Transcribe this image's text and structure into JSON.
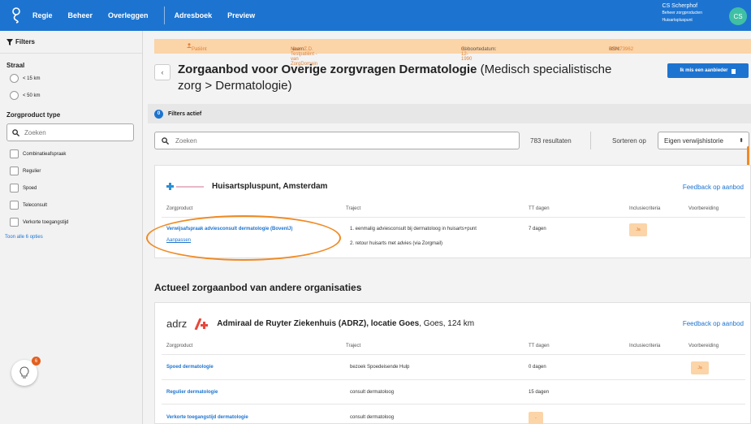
{
  "topnav": {
    "items": [
      "Regie",
      "Beheer",
      "Overleggen",
      "Adresboek",
      "Preview"
    ]
  },
  "user": {
    "name": "CS Scherphof",
    "role": "Beheer zorgproducten",
    "org": "Huisartspluspunt",
    "initials": "CS"
  },
  "sidebar": {
    "title": "Filters",
    "straal": {
      "label": "Straal",
      "options": [
        "< 15 km",
        "< 50 km"
      ]
    },
    "zorgproduct": {
      "label": "Zorgproduct type",
      "placeholder": "Zoeken",
      "options": [
        "Combinatieafspraak",
        "Regulier",
        "Spoed",
        "Teleconsult",
        "Verkorte toegangstijd"
      ],
      "more": "Toon alle 6 opties"
    },
    "notification_count": "6"
  },
  "patient": {
    "label": "Patiënt",
    "naam_label": "Naam:",
    "naam": "Mevr. Z.D. Testpatiënt - van ZorgDomein",
    "geb_label": "Geboortedatum:",
    "geb": "31-12-1990",
    "bsn_label": "BSN:",
    "bsn": "900073962"
  },
  "header": {
    "back": "‹",
    "title_bold": "Zorgaanbod voor Overige zorgvragen Dermatologie",
    "title_rest": " (Medisch specialistische zorg > Dermatologie)",
    "missing_button": "Ik mis een aanbieder"
  },
  "filterbar": {
    "count": "0",
    "label": "Filters actief"
  },
  "search": {
    "placeholder": "Zoeken",
    "results": "783 resultaten",
    "sort_label": "Sorteren op",
    "sort_value": "Eigen verwijshistorie"
  },
  "columns": [
    "Zorgproduct",
    "Traject",
    "TT dagen",
    "Inclusiecriteria",
    "Voorbereiding"
  ],
  "card1": {
    "provider": "Huisartspluspunt, Amsterdam",
    "feedback": "Feedback op aanbod",
    "product": "Verwijsafspraak adviesconsult dermatologie (BovenIJ)",
    "edit": "Aanpassen",
    "traject1": "1. eenmalig adviesconsult bij dermatoloog in huisarts+punt",
    "traject2": "2. retour huisarts met advies (via Zorgmail)",
    "tt": "7 dagen",
    "incl": "Ja"
  },
  "section_title": "Actueel zorgaanbod van andere organisaties",
  "card2": {
    "logo": "adrz",
    "provider": "Admiraal de Ruyter Ziekenhuis (ADRZ), locatie Goes",
    "location": ", Goes, 124 km",
    "feedback": "Feedback op aanbod",
    "rows": [
      {
        "product": "Spoed dermatologie",
        "traject": "bezoek Spoedeisende Hulp",
        "tt": "0 dagen",
        "voorb": "Ja"
      },
      {
        "product": "Regulier dermatologie",
        "traject": "consult dermatoloog",
        "tt": "15 dagen",
        "voorb": ""
      },
      {
        "product": "Verkorte toegangstijd dermatologie",
        "traject": "consult dermatoloog",
        "tt": "-",
        "voorb": ""
      }
    ]
  }
}
